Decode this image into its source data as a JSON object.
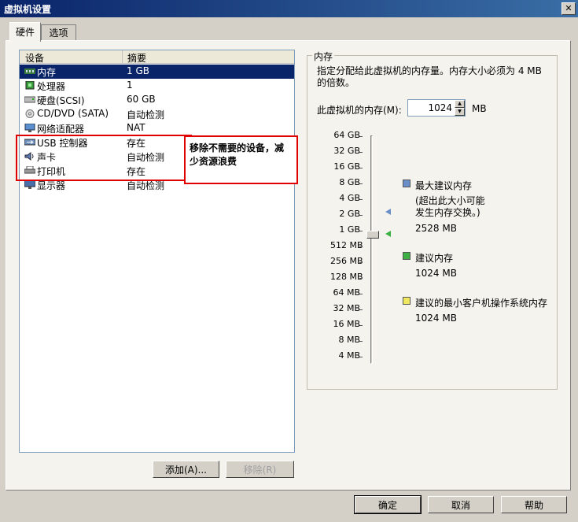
{
  "window": {
    "title": "虚拟机设置",
    "close_label": "✕"
  },
  "tabs": [
    {
      "label": "硬件",
      "active": true
    },
    {
      "label": "选项",
      "active": false
    }
  ],
  "device_list": {
    "col_device": "设备",
    "col_summary": "摘要",
    "rows": [
      {
        "name": "内存",
        "summary": "1 GB",
        "icon": "memory-icon",
        "selected": true
      },
      {
        "name": "处理器",
        "summary": "1",
        "icon": "processor-icon"
      },
      {
        "name": "硬盘(SCSI)",
        "summary": "60 GB",
        "icon": "harddisk-icon"
      },
      {
        "name": "CD/DVD (SATA)",
        "summary": "自动检测",
        "icon": "cdrom-icon"
      },
      {
        "name": "网络适配器",
        "summary": "NAT",
        "icon": "network-icon"
      },
      {
        "name": "USB 控制器",
        "summary": "存在",
        "icon": "usb-icon"
      },
      {
        "name": "声卡",
        "summary": "自动检测",
        "icon": "sound-icon"
      },
      {
        "name": "打印机",
        "summary": "存在",
        "icon": "printer-icon"
      },
      {
        "name": "显示器",
        "summary": "自动检测",
        "icon": "display-icon"
      }
    ]
  },
  "annotation": {
    "text": "移除不需要的设备，减少资源浪费",
    "color": "#e00000"
  },
  "buttons": {
    "add": "添加(A)...",
    "remove": "移除(R)",
    "ok": "确定",
    "cancel": "取消",
    "help": "帮助"
  },
  "memory": {
    "group_title": "内存",
    "description": "指定分配给此虚拟机的内存量。内存大小必须为 4 MB 的倍数。",
    "field_label": "此虚拟机的内存(M):",
    "value": "1024",
    "unit": "MB",
    "scale": [
      "64 GB",
      "32 GB",
      "16 GB",
      "8 GB",
      "4 GB",
      "2 GB",
      "1 GB",
      "512 MB",
      "256 MB",
      "128 MB",
      "64 MB",
      "32 MB",
      "16 MB",
      "8 MB",
      "4 MB"
    ],
    "slider_value": "1 GB",
    "legend": {
      "max_label": "最大建议内存",
      "max_note": "(超出此大小可能发生内存交换。)",
      "max_value": "2528 MB",
      "max_color": "#6a8fc8",
      "rec_label": "建议内存",
      "rec_value": "1024 MB",
      "rec_color": "#3cb043",
      "min_label": "建议的最小客户机操作系统内存",
      "min_value": "1024 MB",
      "min_color": "#f0e860"
    }
  }
}
